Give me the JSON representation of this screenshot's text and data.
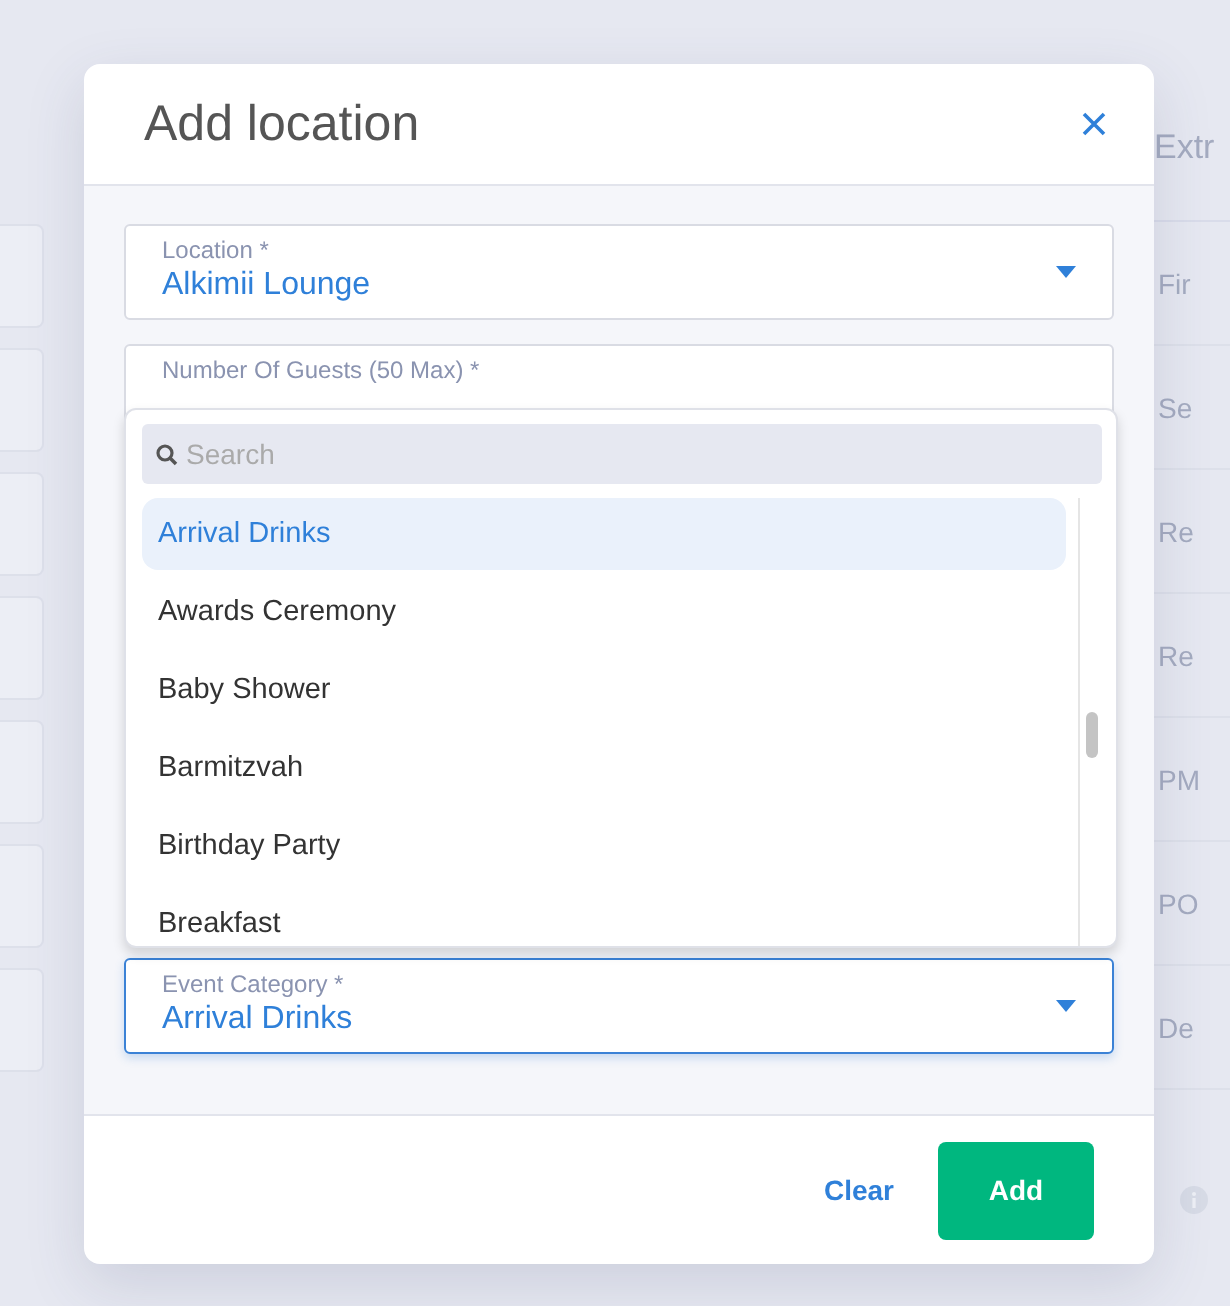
{
  "background": {
    "panel_title": "Extr",
    "rows": [
      "Fir",
      "Se",
      "Re",
      "Re",
      "PM",
      "PO",
      "De"
    ]
  },
  "dialog": {
    "title": "Add location",
    "fields": [
      {
        "label": "Location *",
        "value": "Alkimii Lounge",
        "kind": "select",
        "focused": false
      },
      {
        "label": "Number Of Guests (50 Max) *",
        "kind": "number",
        "focused": false
      },
      {
        "label": "Event Category *",
        "value": "Arrival Drinks",
        "kind": "select",
        "focused": true
      }
    ],
    "dropdown": {
      "search": {
        "placeholder": "Search"
      },
      "options": [
        {
          "label": "Arrival Drinks",
          "selected": true
        },
        {
          "label": "Awards Ceremony",
          "selected": false
        },
        {
          "label": "Baby Shower",
          "selected": false
        },
        {
          "label": "Barmitzvah",
          "selected": false
        },
        {
          "label": "Birthday Party",
          "selected": false
        },
        {
          "label": "Breakfast",
          "selected": false
        }
      ]
    },
    "buttons": [
      {
        "label": "Clear",
        "kind": "text"
      },
      {
        "label": "Add",
        "kind": "primary"
      }
    ]
  }
}
